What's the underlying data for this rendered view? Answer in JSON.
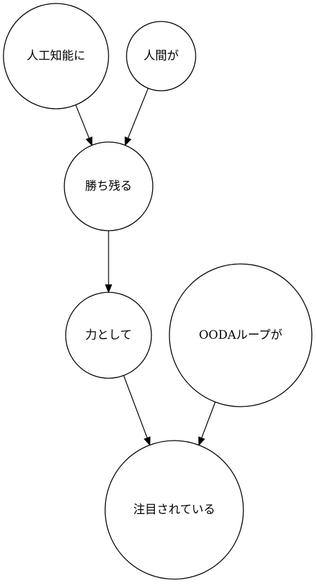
{
  "graph": {
    "nodes": [
      {
        "id": "n1",
        "label": "人工知能に"
      },
      {
        "id": "n2",
        "label": "人間が"
      },
      {
        "id": "n3",
        "label": "勝ち残る"
      },
      {
        "id": "n4",
        "label": "力として"
      },
      {
        "id": "n5",
        "label": "OODAループが"
      },
      {
        "id": "n6",
        "label": "注目されている"
      }
    ],
    "edges": [
      {
        "from": "n1",
        "to": "n3"
      },
      {
        "from": "n2",
        "to": "n3"
      },
      {
        "from": "n3",
        "to": "n4"
      },
      {
        "from": "n4",
        "to": "n6"
      },
      {
        "from": "n5",
        "to": "n6"
      }
    ],
    "colors": {
      "stroke": "#000000",
      "fill": "#ffffff",
      "text": "#000000"
    }
  }
}
